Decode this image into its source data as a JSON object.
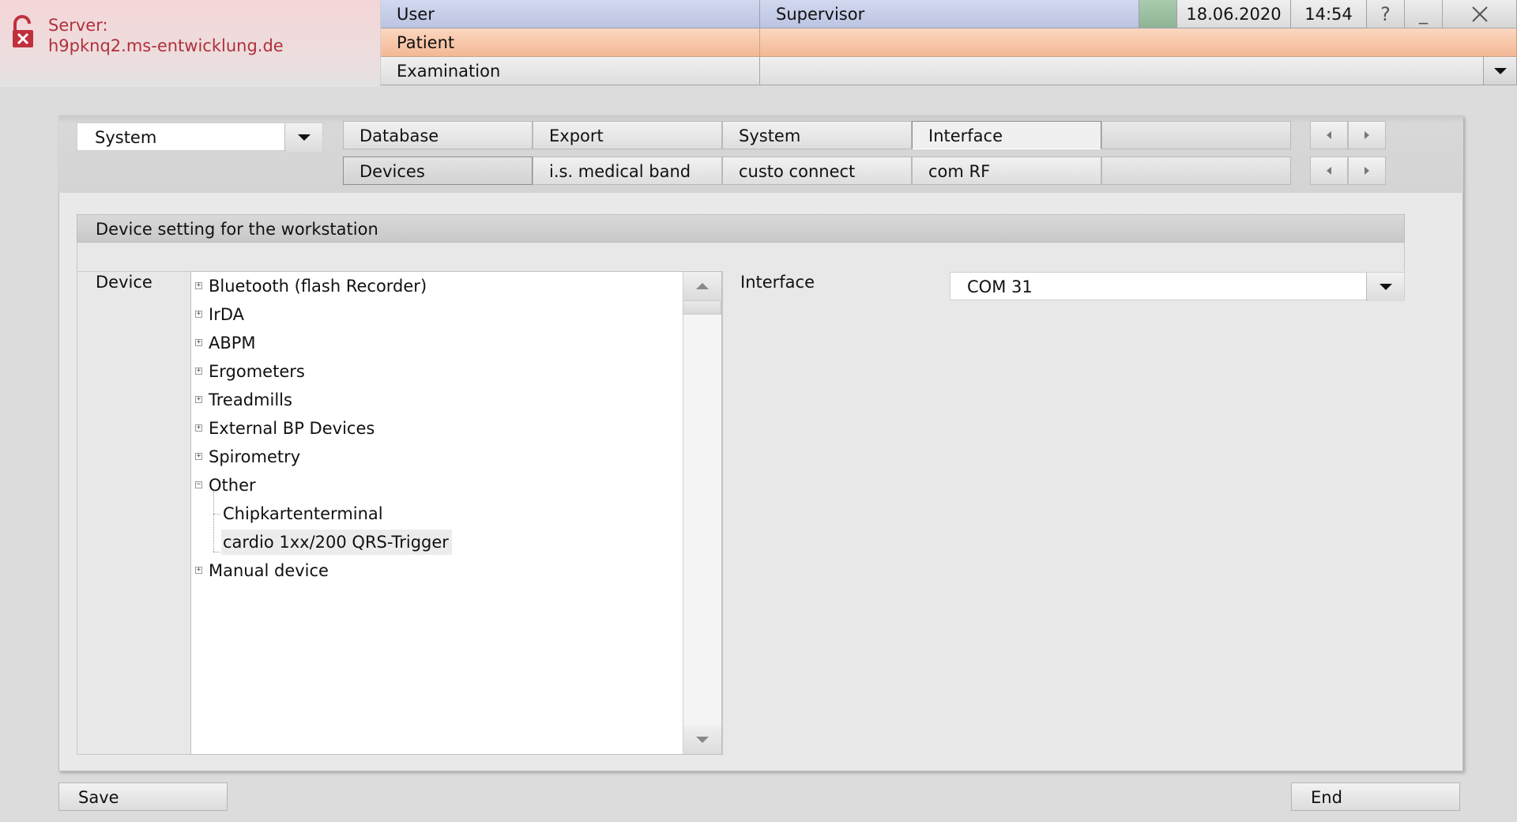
{
  "server": {
    "label": "Server:",
    "name": "h9pknq2.ms-entwicklung.de",
    "icon": "lock-open-error-icon"
  },
  "header": {
    "user_label": "User",
    "user_value": "Supervisor",
    "patient_label": "Patient",
    "patient_value": "",
    "examination_label": "Examination",
    "examination_value": "",
    "date": "18.06.2020",
    "time": "14:54",
    "help": "?",
    "minimize": "_"
  },
  "category_select": {
    "value": "System"
  },
  "tabs_top": [
    {
      "label": "Database"
    },
    {
      "label": "Export"
    },
    {
      "label": "System"
    },
    {
      "label": "Interface"
    },
    {
      "label": ""
    }
  ],
  "tabs_sub": [
    {
      "label": "Devices"
    },
    {
      "label": "i.s. medical band"
    },
    {
      "label": "custo connect"
    },
    {
      "label": "com RF"
    },
    {
      "label": ""
    }
  ],
  "group": {
    "title": "Device setting for the workstation",
    "device_label": "Device",
    "interface_label": "Interface",
    "interface_value": "COM 31"
  },
  "tree": [
    {
      "label": "Bluetooth (flash Recorder)",
      "expanded": false
    },
    {
      "label": "IrDA",
      "expanded": false
    },
    {
      "label": "ABPM",
      "expanded": false
    },
    {
      "label": "Ergometers",
      "expanded": false
    },
    {
      "label": "Treadmills",
      "expanded": false
    },
    {
      "label": "External BP Devices",
      "expanded": false
    },
    {
      "label": "Spirometry",
      "expanded": false
    },
    {
      "label": "Other",
      "expanded": true,
      "children": [
        {
          "label": "Chipkartenterminal"
        },
        {
          "label": "cardio 1xx/200 QRS-Trigger",
          "selected": true
        }
      ]
    },
    {
      "label": "Manual device",
      "expanded": false
    }
  ],
  "buttons": {
    "save": "Save",
    "end": "End"
  },
  "colors": {
    "server_text": "#b0303c",
    "user_row": "#c8cfe9",
    "patient_row": "#f6c2a2",
    "status_green": "#9bbfa1"
  }
}
